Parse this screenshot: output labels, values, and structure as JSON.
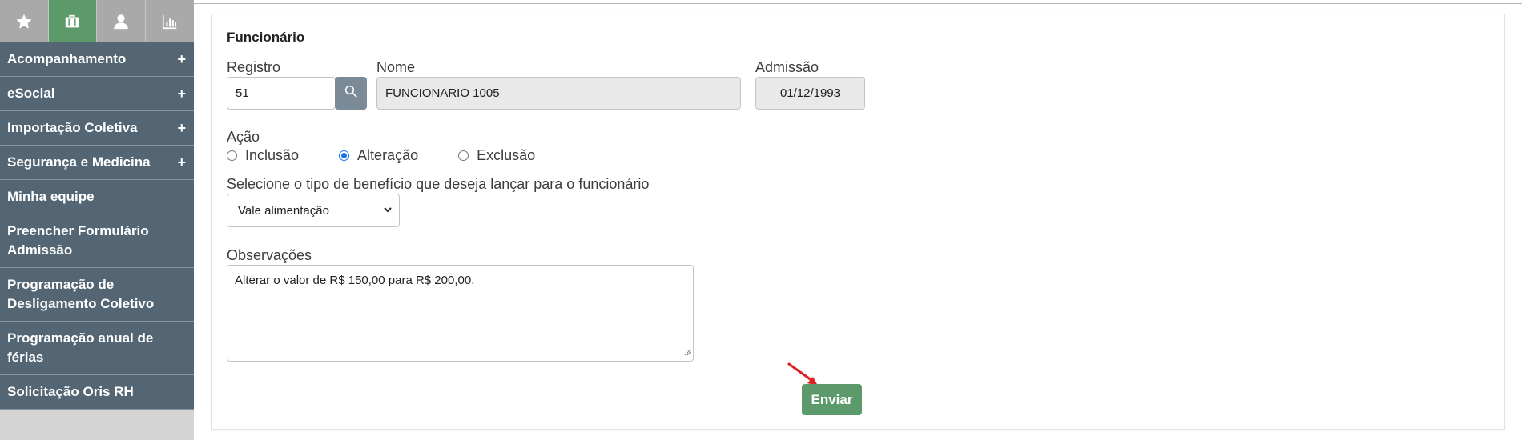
{
  "sidebar": {
    "icon_tabs": [
      {
        "icon": "star-icon",
        "active": false
      },
      {
        "icon": "briefcase-icon",
        "active": true
      },
      {
        "icon": "user-icon",
        "active": false
      },
      {
        "icon": "bar-chart-icon",
        "active": false
      }
    ],
    "items": [
      {
        "label": "Acompanhamento",
        "plus": "+"
      },
      {
        "label": "eSocial",
        "plus": "+"
      },
      {
        "label": "Importação Coletiva",
        "plus": "+"
      },
      {
        "label": "Segurança e Medicina",
        "plus": "+"
      },
      {
        "label": "Minha equipe"
      },
      {
        "label": "Preencher Formulário Admissão"
      },
      {
        "label": "Programação de Desligamento Coletivo"
      },
      {
        "label": "Programação anual de férias"
      },
      {
        "label": "Solicitação Oris RH"
      }
    ],
    "colors": {
      "menu_bg": "#546673",
      "active_tab": "#5c9a6c",
      "tab_bg": "#a9a9a9"
    }
  },
  "form": {
    "section_title": "Funcionário",
    "registro": {
      "label": "Registro",
      "value": "51"
    },
    "nome": {
      "label": "Nome",
      "value": "FUNCIONARIO 1005"
    },
    "admissao": {
      "label": "Admissão",
      "value": "01/12/1993"
    },
    "acao": {
      "label": "Ação",
      "options": [
        {
          "label": "Inclusão",
          "checked": false
        },
        {
          "label": "Alteração",
          "checked": true
        },
        {
          "label": "Exclusão",
          "checked": false
        }
      ]
    },
    "beneficio": {
      "label": "Selecione o tipo de benefício que deseja lançar para o funcionário",
      "selected": "Vale alimentação"
    },
    "observacoes": {
      "label": "Observações",
      "value": "Alterar o valor de R$ 150,00 para R$ 200,00."
    },
    "submit_label": "Enviar",
    "colors": {
      "submit_bg": "#5c9a6c",
      "annotation_arrow": "#e02020"
    }
  }
}
